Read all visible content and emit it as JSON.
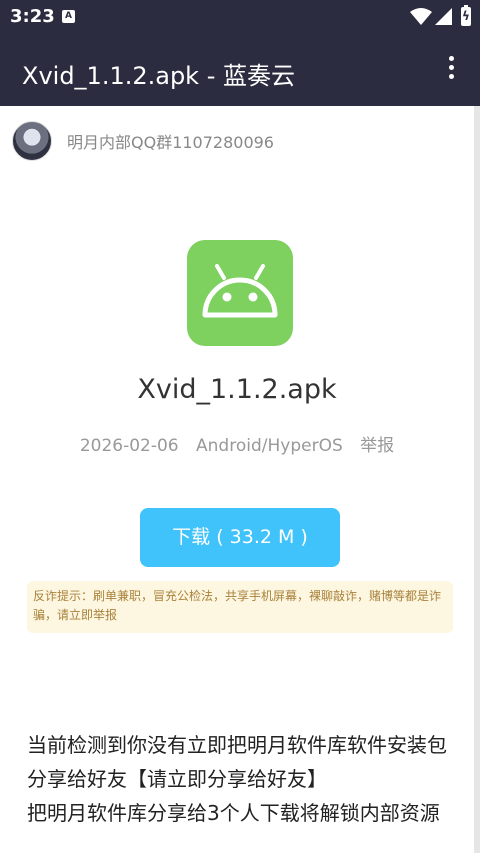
{
  "status_bar": {
    "time": "3:23",
    "notification_icon": "A",
    "battery_glyph": "ϟ"
  },
  "app_bar": {
    "title": "Xvid_1.1.2.apk - 蓝奏云"
  },
  "uploader": {
    "name": "明月内部QQ群1107280096"
  },
  "file": {
    "name": "Xvid_1.1.2.apk",
    "date": "2026-02-06",
    "platform": "Android/HyperOS",
    "report_label": "举报",
    "icon_color": "#7ed15f"
  },
  "download": {
    "label": "下载 ( 33.2 M )"
  },
  "warning": {
    "text": "反诈提示：刷单兼职，冒充公检法，共享手机屏幕，裸聊敲诈，赌博等都是诈骗，请立即举报"
  },
  "description": {
    "line1": "当前检测到你没有立即把明月软件库软件安装包分享给好友【请立即分享给好友】",
    "line2": "把明月软件库分享给3个人下载将解锁内部资源"
  },
  "colors": {
    "header_bg": "#2b2c3f",
    "download_bg": "#3fc3fa",
    "warning_bg": "#fdf6e1"
  }
}
